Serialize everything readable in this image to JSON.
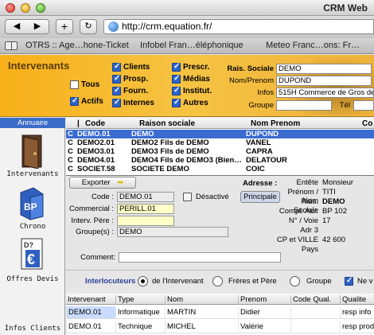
{
  "window": {
    "title": "CRM Web"
  },
  "toolbar": {
    "back": "◀",
    "forward": "▶",
    "add": "+",
    "reload": "↻",
    "url": "http://crm.equation.fr/"
  },
  "bookmarks": [
    "OTRS :: Age…hone-Ticket",
    "Infobel Fran…éléphonique",
    "Meteo Franc…ons: Fr…"
  ],
  "header": {
    "title": "Intervenants",
    "checks": [
      {
        "label": "Tous",
        "checked": false
      },
      {
        "label": "Actifs",
        "checked": true
      },
      {
        "label": "Clients",
        "checked": true
      },
      {
        "label": "Prosp.",
        "checked": true
      },
      {
        "label": "Fourn.",
        "checked": true
      },
      {
        "label": "Internes",
        "checked": true
      },
      {
        "label": "Prescr.",
        "checked": true
      },
      {
        "label": "Médias",
        "checked": true
      },
      {
        "label": "Institut.",
        "checked": true
      },
      {
        "label": "Autres",
        "checked": true
      }
    ],
    "rais_label": "Rais. Sociale",
    "rais_value": "DEMO",
    "nom_label": "Nom/Prenom",
    "nom_value": "DUPOND",
    "infos_label": "Infos",
    "infos_value": "515H Commerce de Gros de",
    "groupe_label": "Groupe",
    "groupe_value": "",
    "tel_label": "Tél",
    "tel_value": ""
  },
  "sidebar": {
    "header": "Annuaire",
    "items": [
      {
        "label": "Intervenants",
        "icon": "door-icon"
      },
      {
        "label": "Chrono",
        "icon": "bp-icon"
      },
      {
        "label": "Offres Devis",
        "icon": "devis-icon"
      },
      {
        "label": "Infos Clients",
        "icon": ""
      }
    ]
  },
  "list": {
    "columns": [
      "Code",
      "Raison sociale",
      "Nom Prenom",
      "Co"
    ],
    "rows": [
      {
        "type": "C",
        "code": "DEMO.01",
        "raison": "DEMO",
        "nom": "DUPOND",
        "selected": true
      },
      {
        "type": "C",
        "code": "DEMO2.01",
        "raison": "DEMO2 Fils de DEMO",
        "nom": "VANEL",
        "selected": false
      },
      {
        "type": "C",
        "code": "DEMO3.01",
        "raison": "DEMO3 Fils de DEMO",
        "nom": "CAPRA",
        "selected": false
      },
      {
        "type": "C",
        "code": "DEMO4.01",
        "raison": "DEMO4 Fils de DEMO3 (Bien…",
        "nom": "DELATOUR",
        "selected": false
      },
      {
        "type": "C",
        "code": "SOCIET.58",
        "raison": "SOCIETE DEMO",
        "nom": "COIC",
        "selected": false
      }
    ]
  },
  "detail": {
    "exporter": "Exporter",
    "code_label": "Code :",
    "code_value": "DEMO.01",
    "desactive": "Désactivé",
    "commercial_label": "Commercial :",
    "commercial_value": "PERILL.01",
    "interv_label": "Interv. Père :",
    "interv_value": "",
    "groupes_label": "Groupe(s) :",
    "groupes_value": "DEMO",
    "comment_label": "Comment:",
    "comment_value": "",
    "adresse_label": "Adresse :",
    "adresse_btn": "Principale",
    "right_fields": [
      {
        "label": "Entête",
        "value": "Monsieur",
        "bold": false
      },
      {
        "label": "Prénom / Nom",
        "value": "TITI",
        "bold": false
      },
      {
        "label": "Rais. Sociale",
        "value": "DEMO",
        "bold": true
      },
      {
        "label": "Compl. Adr.",
        "value": "BP 102",
        "bold": false
      },
      {
        "label": "N° / Voie",
        "value": "17",
        "bold": false
      },
      {
        "label": "Adr 3",
        "value": "",
        "bold": false
      },
      {
        "label": "CP et VILLE",
        "value": "42 600",
        "bold": false
      },
      {
        "label": "Pays",
        "value": "",
        "bold": false
      }
    ]
  },
  "interlocuteurs": {
    "label": "Interlocuteurs :",
    "options": [
      {
        "label": "de l'Intervenant",
        "selected": true
      },
      {
        "label": "Frères et Père",
        "selected": false
      },
      {
        "label": "Groupe",
        "selected": false
      }
    ],
    "ne_label": "Ne v"
  },
  "table": {
    "columns": [
      "Intervenant",
      "Type",
      "Nom",
      "Prenom",
      "Code Qual.",
      "Qualite"
    ],
    "rows": [
      [
        "DEMO.01",
        "Informatique",
        "MARTIN",
        "Didier",
        "",
        "resp info"
      ],
      [
        "DEMO.01",
        "Technique",
        "MICHEL",
        "Valérie",
        "",
        "resp produ"
      ]
    ]
  }
}
